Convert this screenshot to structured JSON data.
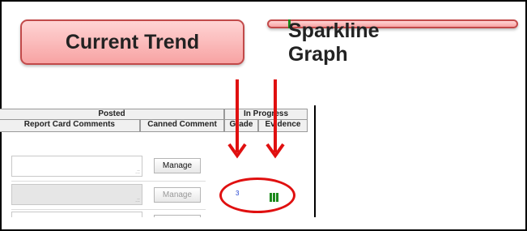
{
  "callouts": {
    "current_trend": "Current Trend",
    "sparkline_graph": "Sparkline Graph"
  },
  "table": {
    "posted_header": "Posted",
    "in_progress_header": "In Progress",
    "columns": {
      "report_card_comments": "Report Card Comments",
      "canned_comment": "Canned Comment",
      "grade": "Grade",
      "evidence": "Evidence"
    },
    "rows": [
      {
        "manage_label": "Manage",
        "enabled": true
      },
      {
        "manage_label": "Manage",
        "enabled": false,
        "grade": "3"
      }
    ]
  },
  "colors": {
    "callout_fill": "#f7a3a3",
    "annotation_red": "#e01010",
    "sparkline_green": "#1c8a1c",
    "grade_blue": "#2040d0"
  }
}
